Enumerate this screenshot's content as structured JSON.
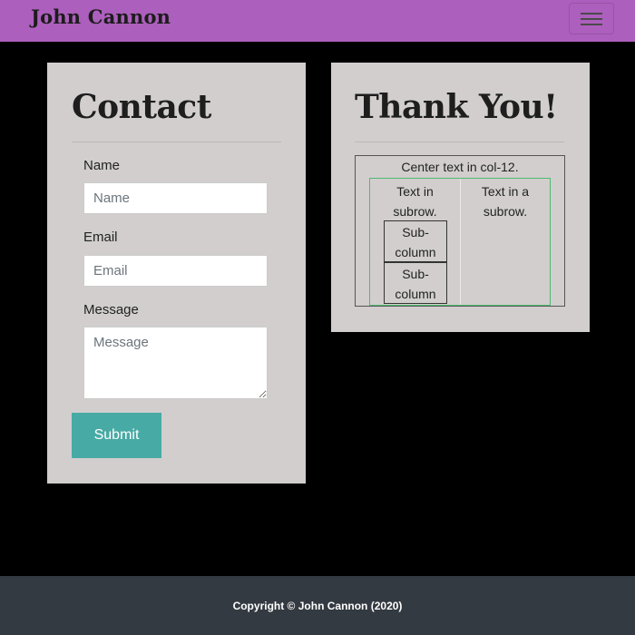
{
  "navbar": {
    "brand": "John Cannon",
    "toggler_icon": "hamburger-menu-icon",
    "background": "#ad5fbd"
  },
  "contact": {
    "title": "Contact",
    "name_label": "Name",
    "name_placeholder": "Name",
    "name_value": "",
    "email_label": "Email",
    "email_placeholder": "Email",
    "email_value": "",
    "message_label": "Message",
    "message_placeholder": "Message",
    "message_value": "",
    "submit_label": "Submit",
    "submit_color": "#47aaa5"
  },
  "thanks": {
    "title": "Thank You!",
    "center_text": "Center text in col-12.",
    "subrow_left": [
      "Text in",
      "subrow."
    ],
    "subrow_right": [
      "Text in a",
      "subrow."
    ],
    "subcolumns": [
      [
        "Sub-",
        "column"
      ],
      [
        "Sub-",
        "column"
      ]
    ]
  },
  "footer": {
    "copyright": "Copyright © John Cannon (2020)"
  },
  "colors": {
    "page_background": "#000000",
    "card_background": "#d2cece",
    "footer_background": "#343a41",
    "nested_border_green": "#4cbb70"
  }
}
